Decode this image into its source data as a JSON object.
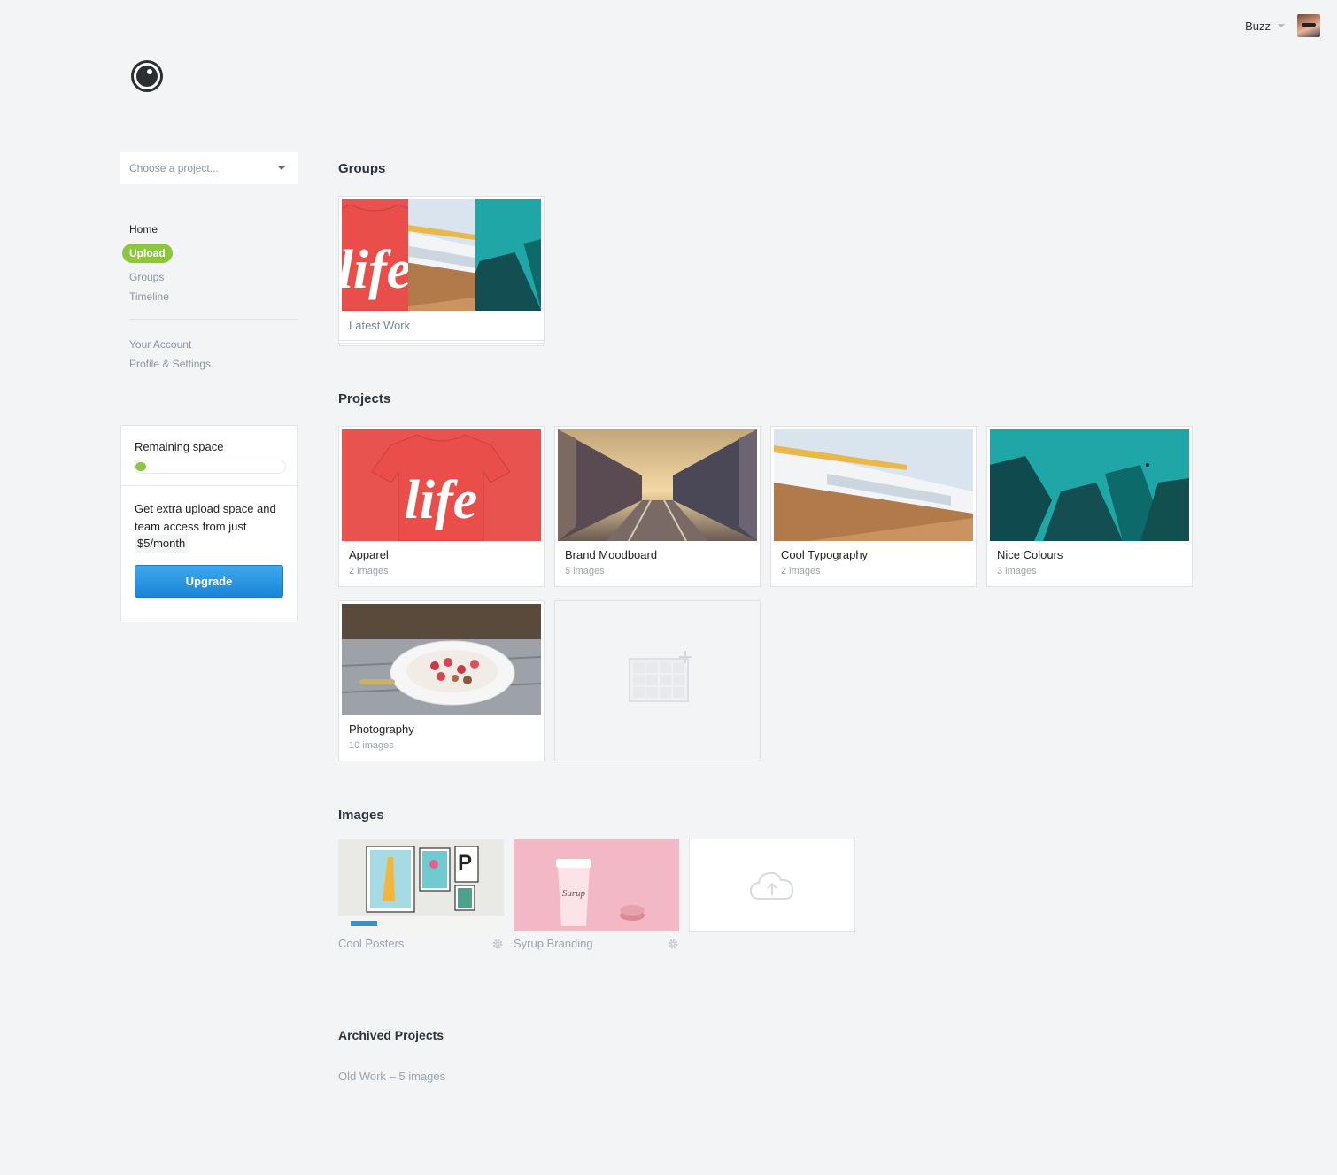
{
  "header": {
    "user_name": "Buzz"
  },
  "sidebar": {
    "project_select_placeholder": "Choose a project...",
    "nav": {
      "home": "Home",
      "upload": "Upload",
      "groups": "Groups",
      "timeline": "Timeline",
      "your_account": "Your Account",
      "profile_settings": "Profile & Settings"
    },
    "storage": {
      "title": "Remaining space",
      "used_fraction": 0.07,
      "promo_text": "Get extra upload space and team access from just",
      "price": "$5/month",
      "upgrade_label": "Upgrade"
    }
  },
  "sections": {
    "groups": "Groups",
    "projects": "Projects",
    "images": "Images",
    "archived": "Archived Projects"
  },
  "groups": [
    {
      "title": "Latest Work"
    }
  ],
  "projects": [
    {
      "title": "Apparel",
      "count": "2 images"
    },
    {
      "title": "Brand Moodboard",
      "count": "5 images"
    },
    {
      "title": "Cool Typography",
      "count": "2 images"
    },
    {
      "title": "Nice Colours",
      "count": "3 images"
    },
    {
      "title": "Photography",
      "count": "10 images"
    }
  ],
  "images": [
    {
      "title": "Cool Posters"
    },
    {
      "title": "Syrup Branding"
    }
  ],
  "archived": [
    {
      "label": "Old Work – 5 images"
    }
  ],
  "colors": {
    "accent_green": "#8cc63f",
    "upgrade_blue": "#1b84d8",
    "background": "#f3f4f6"
  },
  "icons": {
    "logo": "camera-lens-logo",
    "new_project": "grid-plus-icon",
    "upload": "cloud-upload-icon",
    "image_settings": "gear-icon"
  }
}
